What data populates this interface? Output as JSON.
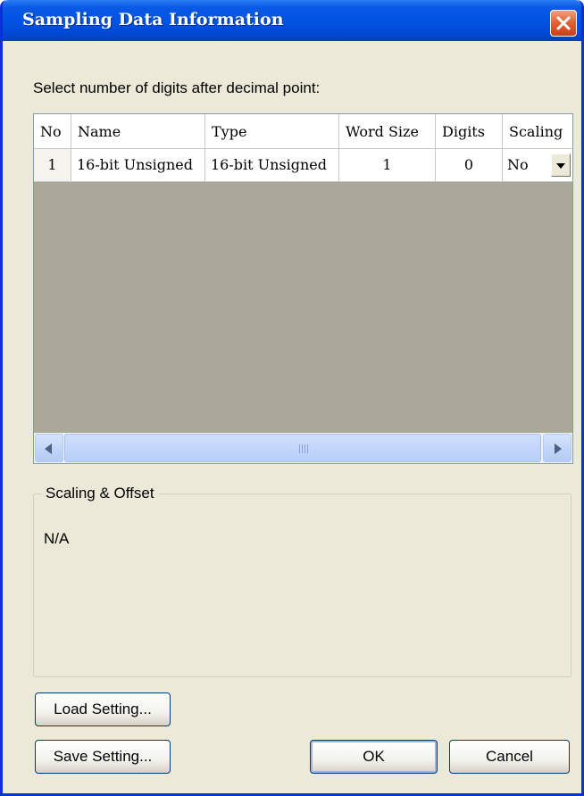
{
  "window": {
    "title": "Sampling Data Information"
  },
  "prompt": "Select number of digits after decimal point:",
  "table": {
    "columns": [
      "No",
      "Name",
      "Type",
      "Word Size",
      "Digits",
      "Scaling"
    ],
    "rows": [
      {
        "no": "1",
        "name": "16-bit Unsigned",
        "type": "16-bit Unsigned",
        "word_size": "1",
        "digits": "0",
        "scaling": "No"
      }
    ]
  },
  "group": {
    "title": "Scaling & Offset",
    "value": "N/A"
  },
  "buttons": {
    "load": "Load Setting...",
    "save": "Save Setting...",
    "ok": "OK",
    "cancel": "Cancel"
  },
  "colors": {
    "titlebar": "#0054e3",
    "dialog_bg": "#ece9d8",
    "grid_empty": "#aca899",
    "close": "#e2643c"
  }
}
